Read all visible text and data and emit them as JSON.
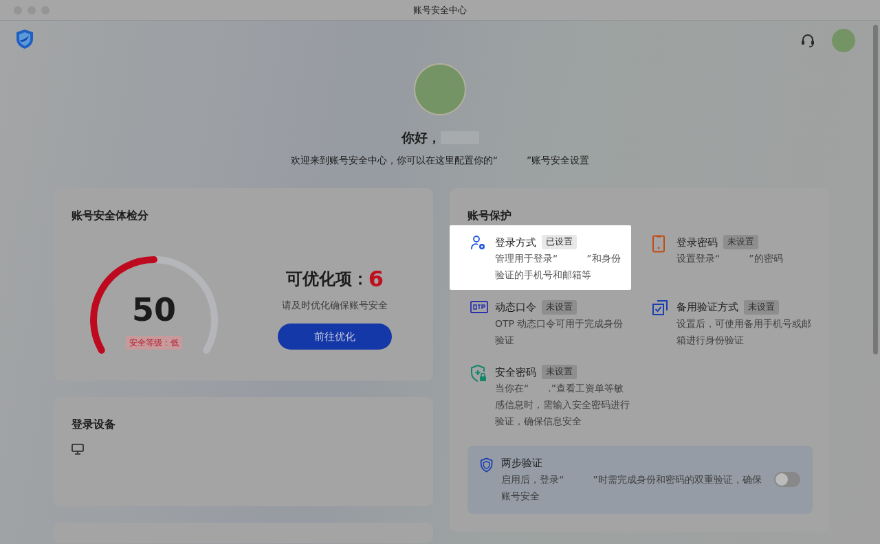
{
  "window": {
    "title": "账号安全中心"
  },
  "greeting": {
    "text": "你好，",
    "welcome": "欢迎来到账号安全中心，你可以在这里配置你的“　　　”账号安全设置"
  },
  "score_card": {
    "title": "账号安全体检分",
    "score": "50",
    "level": 0.5,
    "grade": "安全等级：低",
    "optimizable_label": "可优化项：",
    "optimizable_count": "6",
    "hint": "请及时优化确保账号安全",
    "button": "前往优化"
  },
  "devices_card": {
    "title": "登录设备"
  },
  "protection": {
    "title": "账号保护",
    "items": [
      {
        "kind": "login-method",
        "title": "登录方式",
        "status": "已设置",
        "configured": true,
        "highlighted": true,
        "description": "管理用于登录“　　　”和身份验证的手机号和邮箱等"
      },
      {
        "kind": "password",
        "title": "登录密码",
        "status": "未设置",
        "configured": false,
        "highlighted": false,
        "description": "设置登录“　　　”的密码"
      },
      {
        "kind": "otp",
        "title": "动态口令",
        "status": "未设置",
        "configured": false,
        "highlighted": false,
        "description": "OTP 动态口令可用于完成身份验证"
      },
      {
        "kind": "backup",
        "title": "备用验证方式",
        "status": "未设置",
        "configured": false,
        "highlighted": false,
        "description": "设置后，可使用备用手机号或邮箱进行身份验证"
      },
      {
        "kind": "security-password",
        "title": "安全密码",
        "status": "未设置",
        "configured": false,
        "highlighted": false,
        "description": "当你在“　　.”查看工资单等敏感信息时，需输入安全密码进行验证，确保信息安全"
      }
    ],
    "two_step": {
      "title": "两步验证",
      "description": "启用后，登录“　　　”时需完成身份和密码的双重验证，确保账号安全",
      "on": false
    }
  }
}
